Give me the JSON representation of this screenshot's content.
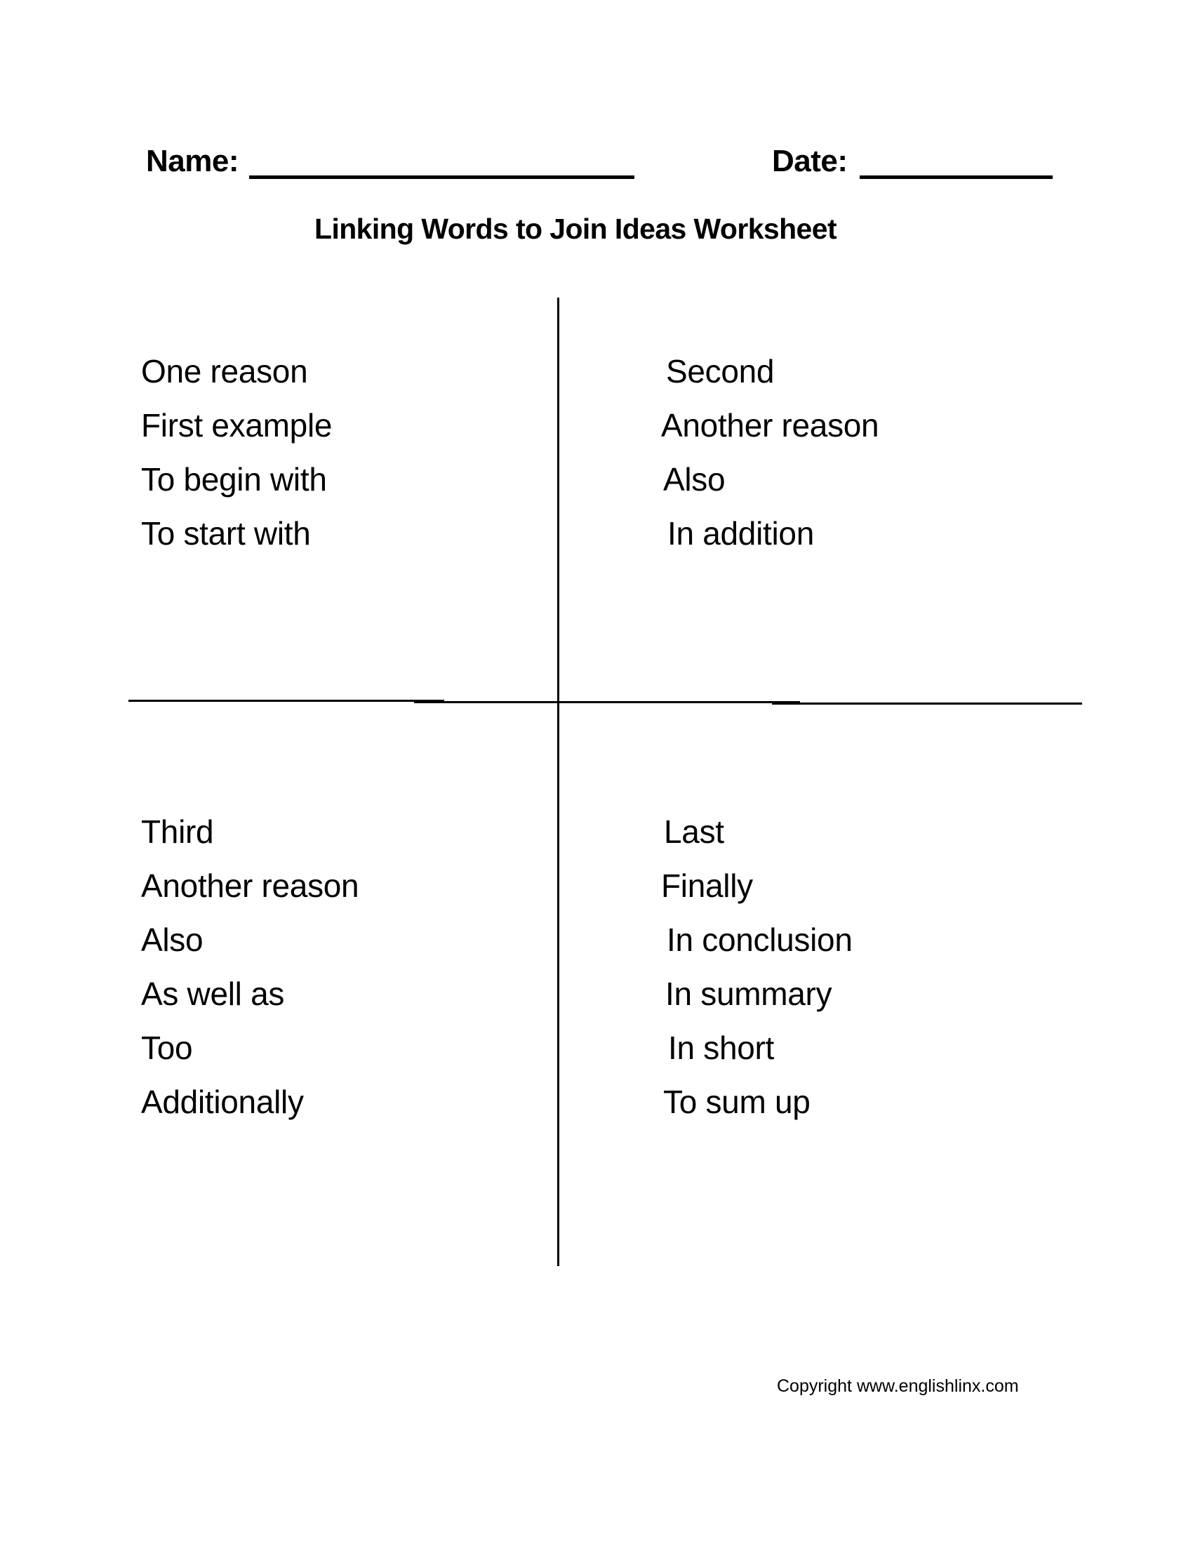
{
  "header": {
    "name_label": "Name:",
    "date_label": "Date:"
  },
  "title": "Linking Words to Join Ideas Worksheet",
  "quadrants": {
    "top_left": [
      "One reason",
      "First example",
      "To begin with",
      "To start with"
    ],
    "top_right": [
      "Second",
      "Another reason",
      "Also",
      "In addition"
    ],
    "bottom_left": [
      "Third",
      "Another reason",
      "Also",
      "As well as",
      "Too",
      "Additionally"
    ],
    "bottom_right": [
      "Last",
      "Finally",
      "In conclusion",
      "In summary",
      "In short",
      "To sum up"
    ]
  },
  "footer": {
    "copyright": "Copyright www.englishlinx.com"
  }
}
